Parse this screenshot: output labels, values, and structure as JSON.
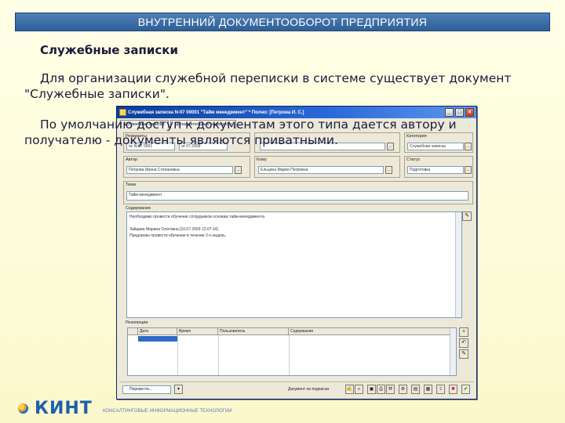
{
  "header": {
    "title": "ВНУТРЕННИЙ ДОКУМЕНТООБОРОТ ПРЕДПРИЯТИЯ"
  },
  "slide": {
    "title": "Служебные записки",
    "paragraph1": "Для организации служебной переписки в системе существует документ \"Служебные записки\".",
    "paragraph2": "По умолчанию доступ к документам этого типа дается автору и получателю - документы являются приватными."
  },
  "window": {
    "title": "Служебная записка N-07 00001 \"Тайм менеджмент\" * Полно: [Петрова И. С.]",
    "tabs": [
      "Служебная записка",
      "Дополнительные реквизиты"
    ],
    "fields": {
      "number_label": "Реквизиты",
      "number_value": "№ N-07 0001",
      "date_value": "от 07.2009",
      "author_label": "Автор",
      "author_value": "Петрова Ирина Степановна",
      "recipient_label": "Кому",
      "recipient_value": "Ельцина Мария Петровна",
      "category_label": "Категория",
      "category_value": "Служебная записка",
      "status_label": "Статус",
      "status_value": "Подготовка",
      "subject_label": "Тема",
      "subject_value": "Тайм менеджмент",
      "content_label": "Содержание",
      "content_line1": "Необходимо провести обучение сотрудников основам тайм-менеджмента",
      "content_line2": "Зайцева Марина Олеговна [10.07.2009 12:07:14]",
      "content_line3": "Предлагаю провести обучение в течение 2-х недель.",
      "resolutions_label": "Резолюции"
    },
    "grid_headers": [
      "Дата",
      "Время",
      "Пользователь",
      "Содержание"
    ],
    "status_bar": {
      "combo": "Перевести...",
      "text": "Документ не подписан"
    }
  },
  "footer": {
    "logo": "КИНТ",
    "tagline": "КОНСАЛТИНГОВЫЕ ИНФОРМАЦИОННЫЕ ТЕХНОЛОГИИ"
  }
}
